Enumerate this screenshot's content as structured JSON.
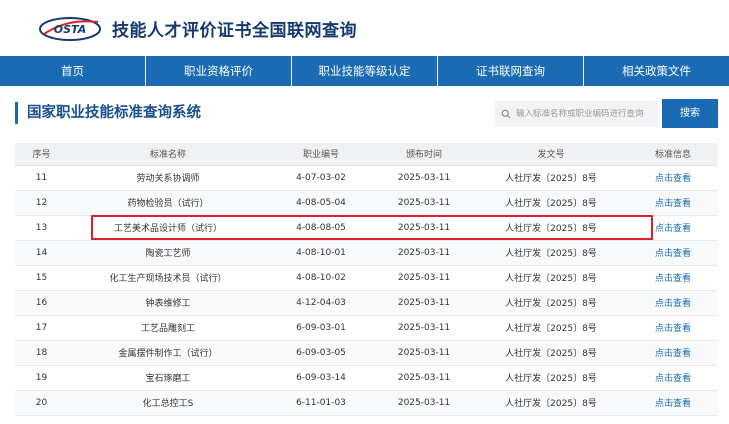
{
  "header": {
    "logo_text": "OSTA",
    "site_title": "技能人才评价证书全国联网查询"
  },
  "nav": {
    "items": [
      {
        "label": "首页"
      },
      {
        "label": "职业资格评价"
      },
      {
        "label": "职业技能等级认定"
      },
      {
        "label": "证书联网查询"
      },
      {
        "label": "相关政策文件"
      }
    ]
  },
  "main": {
    "page_title": "国家职业技能标准查询系统",
    "search": {
      "placeholder": "输入标准名称或职业编码进行查询",
      "button_label": "搜索"
    },
    "table": {
      "headers": [
        "序号",
        "标准名称",
        "职业编号",
        "颁布时间",
        "发文号",
        "标准信息"
      ],
      "rows": [
        {
          "no": "11",
          "name": "劳动关系协调师",
          "code": "4-07-03-02",
          "date": "2025-03-11",
          "doc": "人社厅发〔2025〕8号",
          "action": "点击查看"
        },
        {
          "no": "12",
          "name": "药物检验员（试行）",
          "code": "4-08-05-04",
          "date": "2025-03-11",
          "doc": "人社厅发〔2025〕8号",
          "action": "点击查看"
        },
        {
          "no": "13",
          "name": "工艺美术品设计师（试行）",
          "code": "4-08-08-05",
          "date": "2025-03-11",
          "doc": "人社厅发〔2025〕8号",
          "action": "点击查看"
        },
        {
          "no": "14",
          "name": "陶瓷工艺师",
          "code": "4-08-10-01",
          "date": "2025-03-11",
          "doc": "人社厅发〔2025〕8号",
          "action": "点击查看"
        },
        {
          "no": "15",
          "name": "化工生产现场技术员（试行）",
          "code": "4-08-10-02",
          "date": "2025-03-11",
          "doc": "人社厅发〔2025〕8号",
          "action": "点击查看"
        },
        {
          "no": "16",
          "name": "钟表维修工",
          "code": "4-12-04-03",
          "date": "2025-03-11",
          "doc": "人社厅发〔2025〕8号",
          "action": "点击查看"
        },
        {
          "no": "17",
          "name": "工艺品雕刻工",
          "code": "6-09-03-01",
          "date": "2025-03-11",
          "doc": "人社厅发〔2025〕8号",
          "action": "点击查看"
        },
        {
          "no": "18",
          "name": "金属摆件制作工（试行）",
          "code": "6-09-03-05",
          "date": "2025-03-11",
          "doc": "人社厅发〔2025〕8号",
          "action": "点击查看"
        },
        {
          "no": "19",
          "name": "宝石琢磨工",
          "code": "6-09-03-14",
          "date": "2025-03-11",
          "doc": "人社厅发〔2025〕8号",
          "action": "点击查看"
        },
        {
          "no": "20",
          "name": "化工总控工S",
          "code": "6-11-01-03",
          "date": "2025-03-11",
          "doc": "人社厅发〔2025〕8号",
          "action": "点击查看"
        }
      ]
    }
  },
  "colors": {
    "nav_bg": "#1a6bb3",
    "title_text": "#1a4f8c",
    "link": "#1a6bb3",
    "highlight": "#d8232a"
  }
}
